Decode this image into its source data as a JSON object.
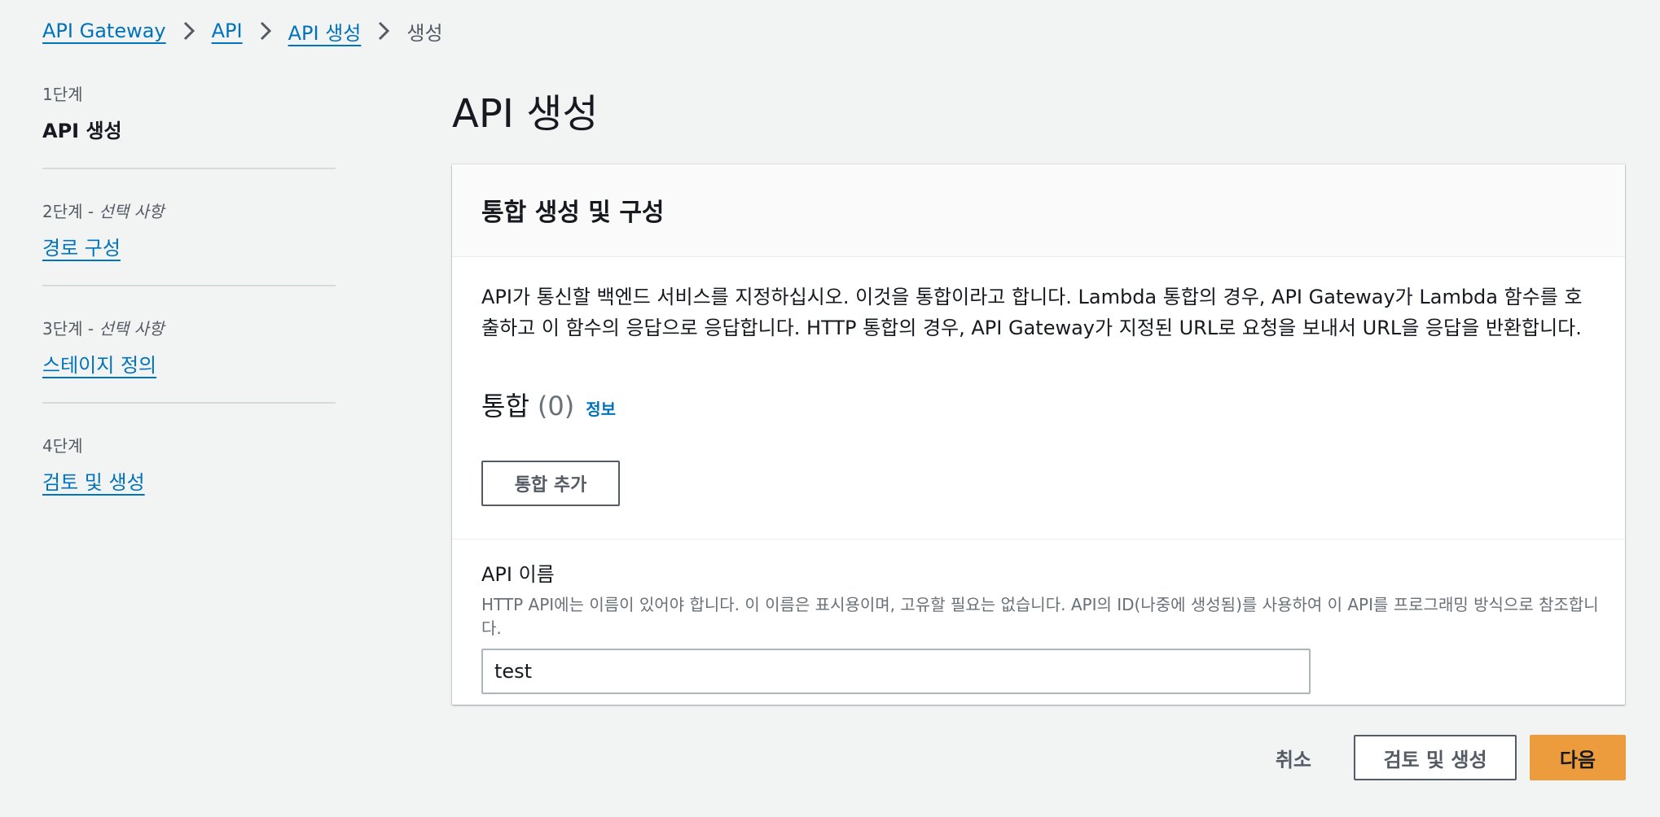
{
  "breadcrumb": {
    "items": [
      "API Gateway",
      "API",
      "API 생성"
    ],
    "current": "생성"
  },
  "steps": [
    {
      "label": "1단계",
      "optional": "",
      "title": "API 생성",
      "current": true
    },
    {
      "label": "2단계",
      "optional": "선택 사항",
      "title": "경로 구성",
      "current": false
    },
    {
      "label": "3단계",
      "optional": "선택 사항",
      "title": "스테이지 정의",
      "current": false
    },
    {
      "label": "4단계",
      "optional": "",
      "title": "검토 및 생성",
      "current": false
    }
  ],
  "step_separator": " - ",
  "page_title": "API 생성",
  "panel": {
    "title": "통합 생성 및 구성",
    "description": "API가 통신할 백엔드 서비스를 지정하십시오. 이것을 통합이라고 합니다. Lambda 통합의 경우, API Gateway가 Lambda 함수를 호출하고 이 함수의 응답으로 응답합니다. HTTP 통합의 경우, API Gateway가 지정된 URL로 요청을 보내서 URL을 응답을 반환합니다.",
    "integrations": {
      "title": "통합",
      "count": "(0)",
      "info": "정보"
    },
    "add_integration_label": "통합 추가",
    "api_name": {
      "label": "API 이름",
      "description": "HTTP API에는 이름이 있어야 합니다. 이 이름은 표시용이며, 고유할 필요는 없습니다. API의 ID(나중에 생성됨)를 사용하여 이 API를 프로그래밍 방식으로 참조합니다.",
      "value": "test"
    }
  },
  "actions": {
    "cancel": "취소",
    "review_create": "검토 및 생성",
    "next": "다음"
  },
  "colors": {
    "link": "#0073bb",
    "primary_button": "#ec9c3d",
    "background": "#f2f3f3"
  },
  "icons": {
    "breadcrumb_separator": "chevron-right-icon"
  }
}
